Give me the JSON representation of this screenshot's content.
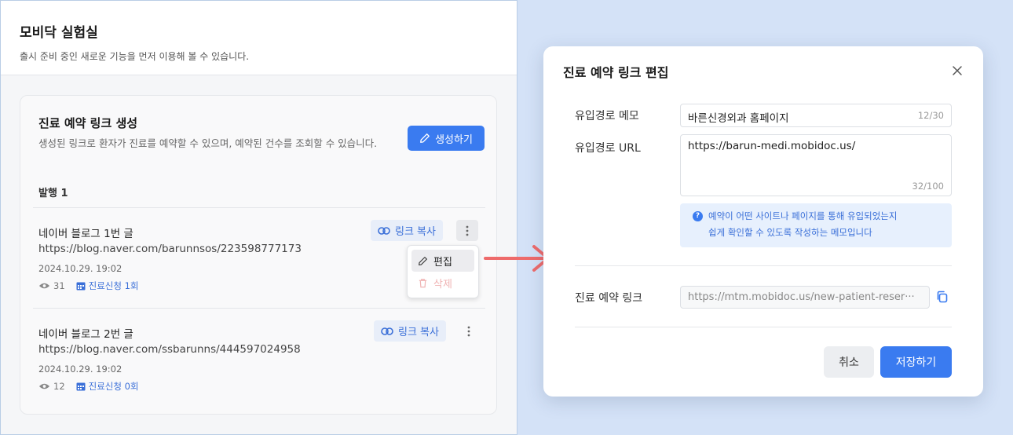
{
  "lab": {
    "title": "모비닥 실험실",
    "subtitle": "출시 준비 중인 새로운 기능을 먼저 이용해 볼 수 있습니다."
  },
  "card": {
    "title": "진료 예약 링크 생성",
    "description": "생성된 링크로 환자가 진료를 예약할 수 있으며, 예약된 건수를 조회할 수 있습니다.",
    "create_label": "생성하기",
    "issued_label": "발행 1"
  },
  "links": [
    {
      "name": "네이버 블로그 1번 글",
      "url": "https://blog.naver.com/barunnsos/223598777173",
      "date": "2024.10.29. 19:02",
      "views": "31",
      "requests": "진료신청 1회",
      "copy_label": "링크 복사"
    },
    {
      "name": "네이버 블로그 2번 글",
      "url": "https://blog.naver.com/ssbarunns/444597024958",
      "date": "2024.10.29. 19:02",
      "views": "12",
      "requests": "진료신청 0회",
      "copy_label": "링크 복사"
    }
  ],
  "dropdown": {
    "edit_label": "편집",
    "delete_label": "삭제"
  },
  "modal": {
    "title": "진료 예약 링크 편집",
    "memo_label": "유입경로 메모",
    "memo_value": "바른신경외과 홈페이지",
    "memo_count": "12/30",
    "url_label": "유입경로 URL",
    "url_value": "https://barun-medi.mobidoc.us/",
    "url_count": "32/100",
    "hint_line1": "예약이 어떤 사이트나 페이지를 통해 유입되었는지",
    "hint_line2": "쉽게 확인할 수 있도록 작성하는 메모입니다",
    "link_label": "진료 예약 링크",
    "link_value": "https://mtm.mobidoc.us/new-patient-reser···",
    "cancel_label": "취소",
    "save_label": "저장하기"
  },
  "colors": {
    "accent": "#3a7bf0",
    "link": "#3a6fd8",
    "background": "#d4e2f7",
    "arrow": "#ee6b6b"
  }
}
